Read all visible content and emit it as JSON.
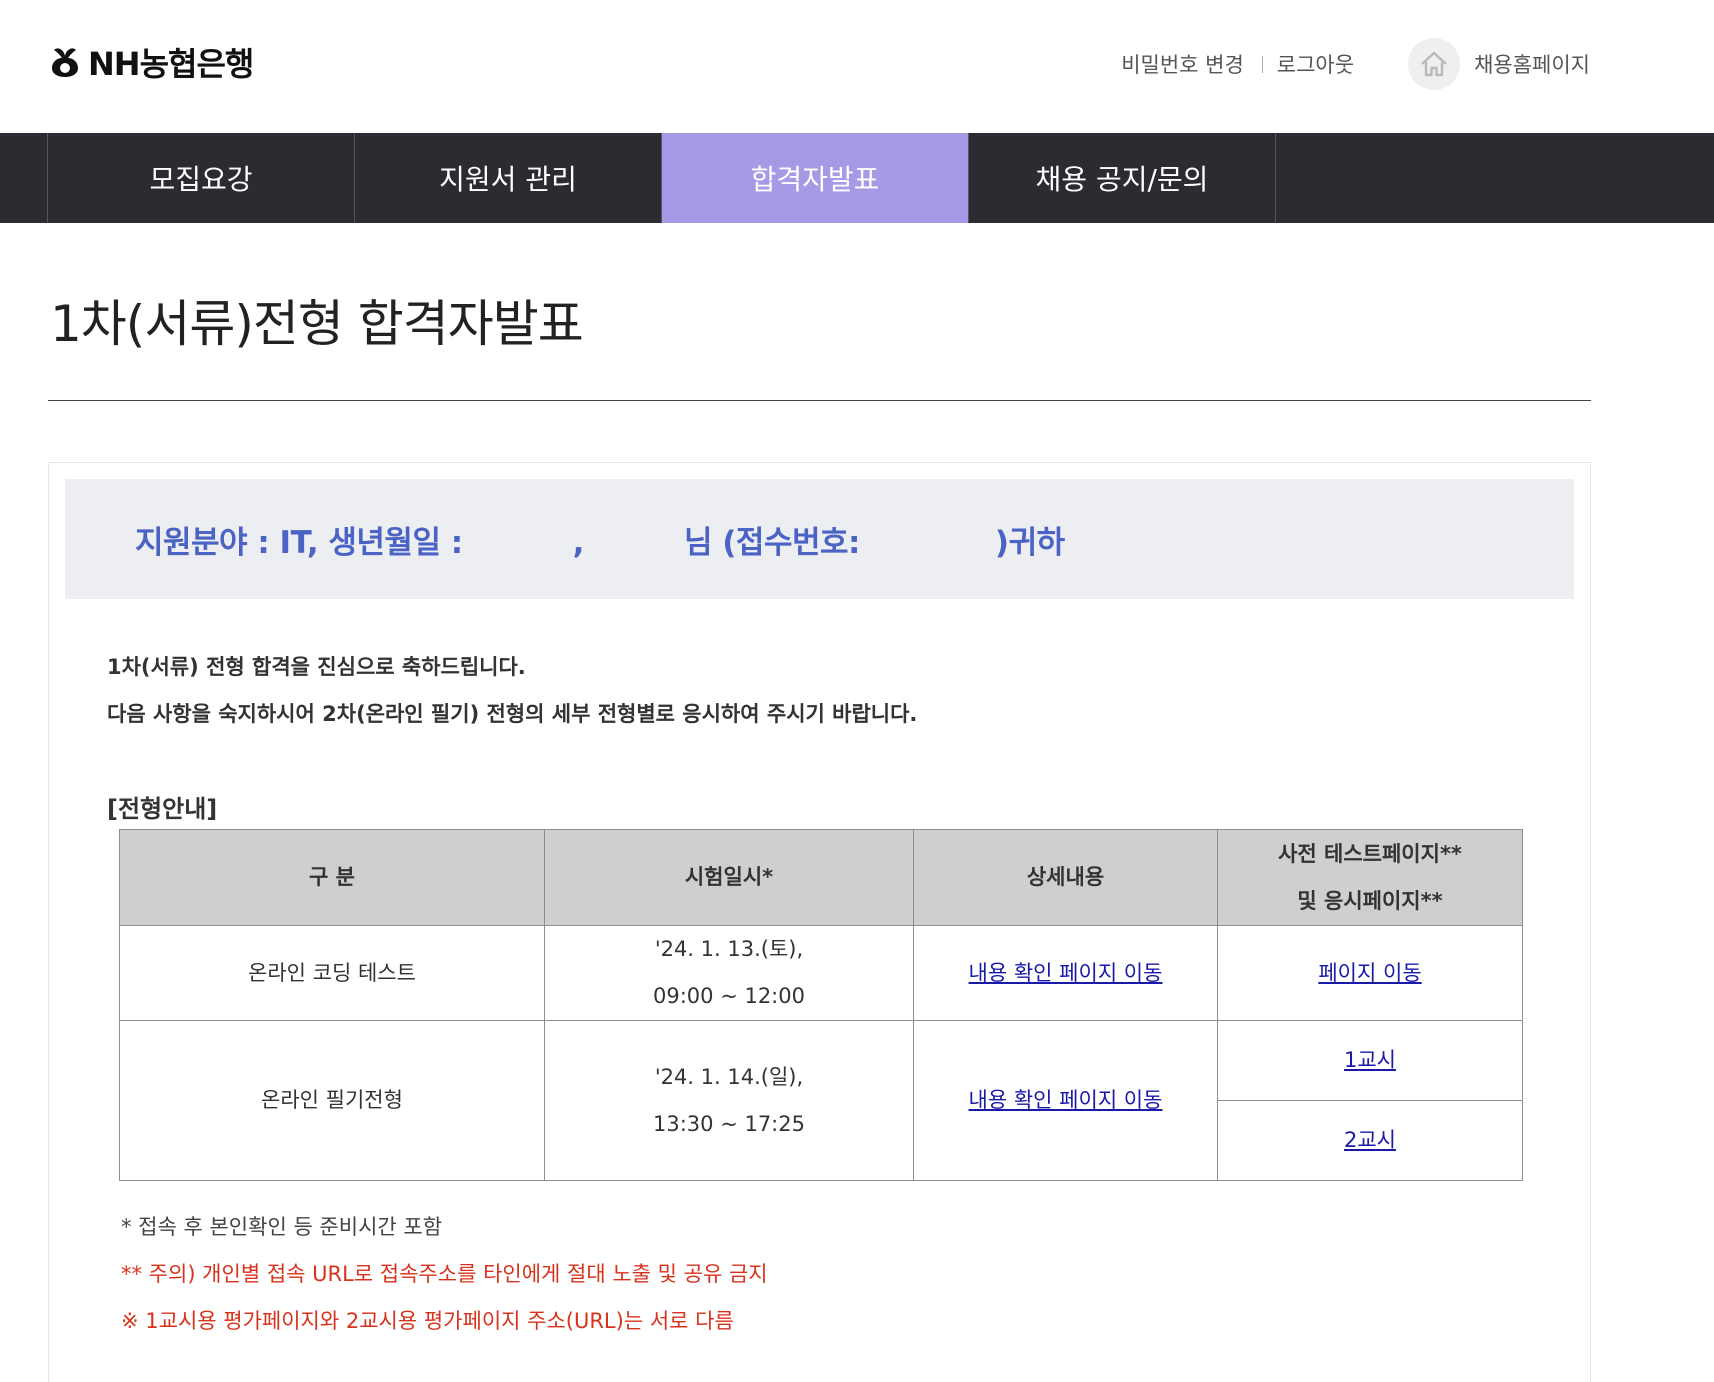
{
  "header": {
    "logo_text": "NH농협은행",
    "change_password": "비밀번호 변경",
    "logout": "로그아웃",
    "recruit_home": "채용홈페이지"
  },
  "nav": {
    "items": [
      {
        "label": "모집요강"
      },
      {
        "label": "지원서 관리"
      },
      {
        "label": "합격자발표"
      },
      {
        "label": "채용 공지/문의"
      }
    ],
    "active_index": 2
  },
  "page": {
    "title": "1차(서류)전형 합격자발표"
  },
  "applicant": {
    "field_label": "지원분야 : IT, 생년월일 :",
    "comma": ",",
    "honorific": "님 (접수번호:",
    "closing": ")귀하"
  },
  "message": {
    "line1": "1차(서류) 전형 합격을 진심으로 축하드립니다.",
    "line2": "다음 사항을 숙지하시어 2차(온라인 필기) 전형의 세부 전형별로 응시하여 주시기 바랍니다."
  },
  "guide": {
    "heading": "[전형안내]",
    "columns": [
      "구 분",
      "시험일시*",
      "상세내용",
      "사전 테스트페이지**",
      "및 응시페이지**"
    ],
    "rows": [
      {
        "category": "온라인 코딩 테스트",
        "date_line1": "'24. 1. 13.(토),",
        "date_line2": "09:00 ~ 12:00",
        "detail_link": "내용 확인 페이지 이동",
        "page_link": "페이지 이동"
      },
      {
        "category": "온라인 필기전형",
        "date_line1": "'24. 1. 14.(일),",
        "date_line2": "13:30 ~ 17:25",
        "detail_link": "내용 확인 페이지 이동",
        "page_link_1": "1교시",
        "page_link_2": "2교시"
      }
    ]
  },
  "notes": {
    "note1": "* 접속 후 본인확인 등 준비시간 포함",
    "note2": "** 주의) 개인별 접속 URL로 접속주소를 타인에게 절대 노출 및 공유 금지",
    "note3": "※ 1교시용 평가페이지와 2교시용 평가페이지 주소(URL)는 서로 다름"
  },
  "colors": {
    "nav_bg": "#2b2c32",
    "nav_active": "#a49ae6",
    "banner_bg": "#eceef2",
    "banner_text": "#4a63c4",
    "table_header_bg": "#cfcfcf",
    "link": "#1a1aa8",
    "warning_red": "#d8321c"
  }
}
